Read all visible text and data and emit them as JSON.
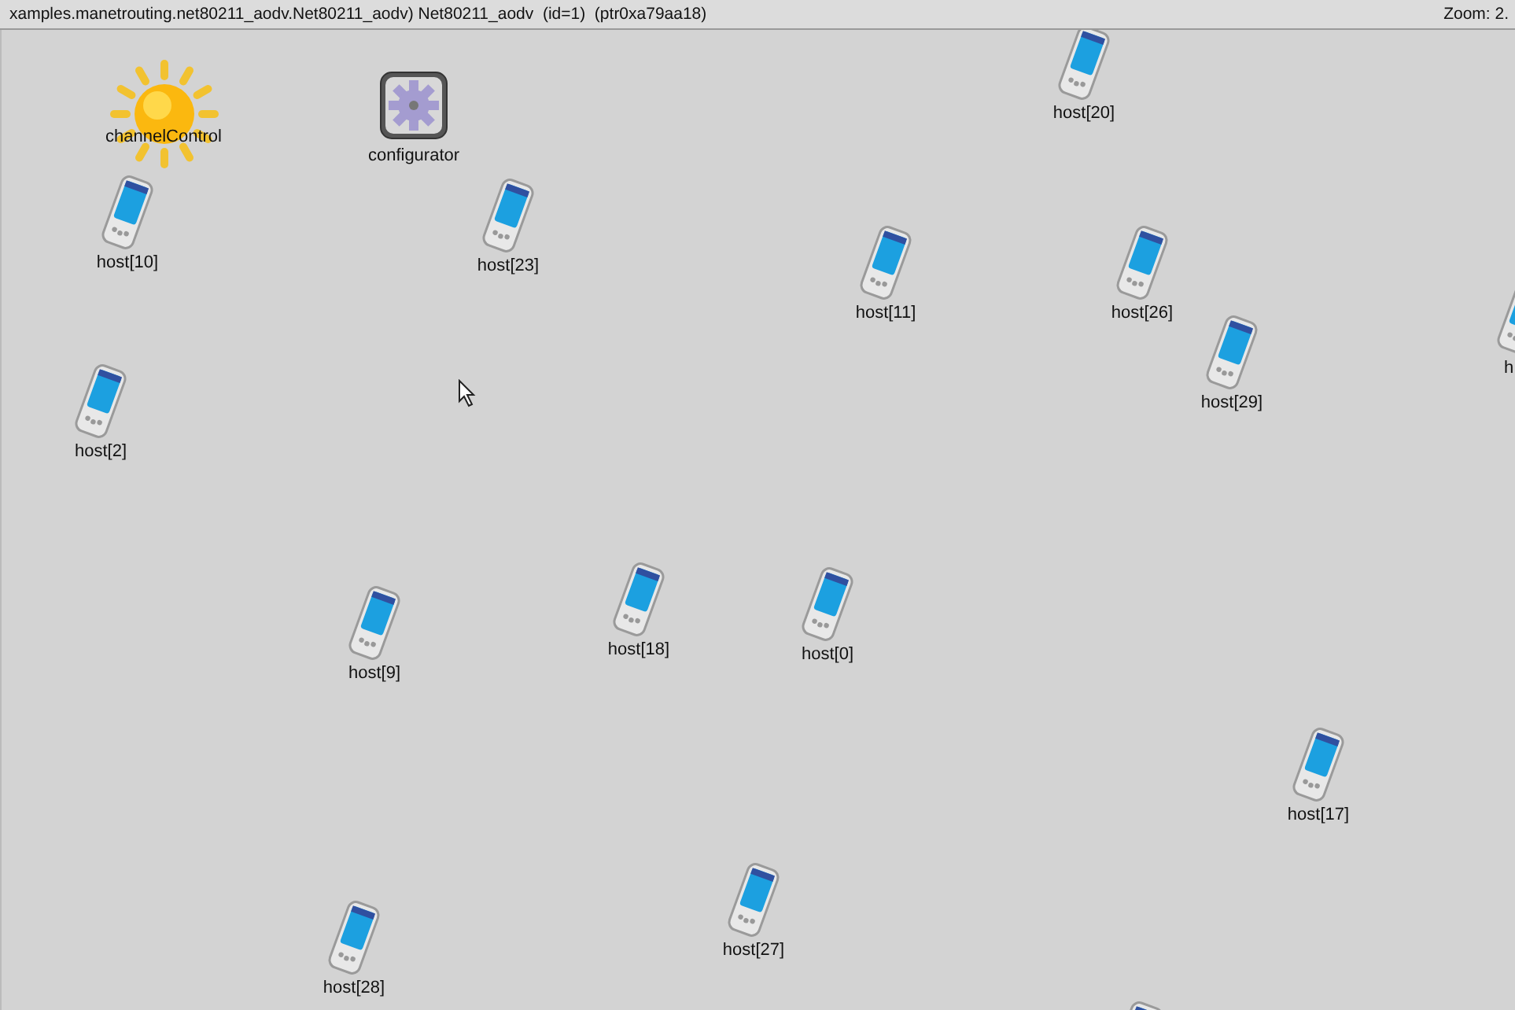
{
  "header": {
    "title": "xamples.manetrouting.net80211_aodv.Net80211_aodv) Net80211_aodv  (id=1)  (ptr0xa79aa18)",
    "zoom": "Zoom: 2."
  },
  "nodes": [
    {
      "kind": "sun",
      "label": "channelControl"
    },
    {
      "kind": "gear",
      "label": "configurator"
    },
    {
      "kind": "host",
      "label": "host[20]"
    },
    {
      "kind": "host",
      "label": "host[10]"
    },
    {
      "kind": "host",
      "label": "host[23]"
    },
    {
      "kind": "host",
      "label": "host[11]"
    },
    {
      "kind": "host",
      "label": "host[26]"
    },
    {
      "kind": "host",
      "label": "host[29]"
    },
    {
      "kind": "host",
      "label": "h"
    },
    {
      "kind": "host",
      "label": "host[2]"
    },
    {
      "kind": "host",
      "label": "host[9]"
    },
    {
      "kind": "host",
      "label": "host[18]"
    },
    {
      "kind": "host",
      "label": "host[0]"
    },
    {
      "kind": "host",
      "label": "host[17]"
    },
    {
      "kind": "host",
      "label": "host[27]"
    },
    {
      "kind": "host",
      "label": "host[28]"
    },
    {
      "kind": "host"
    }
  ]
}
